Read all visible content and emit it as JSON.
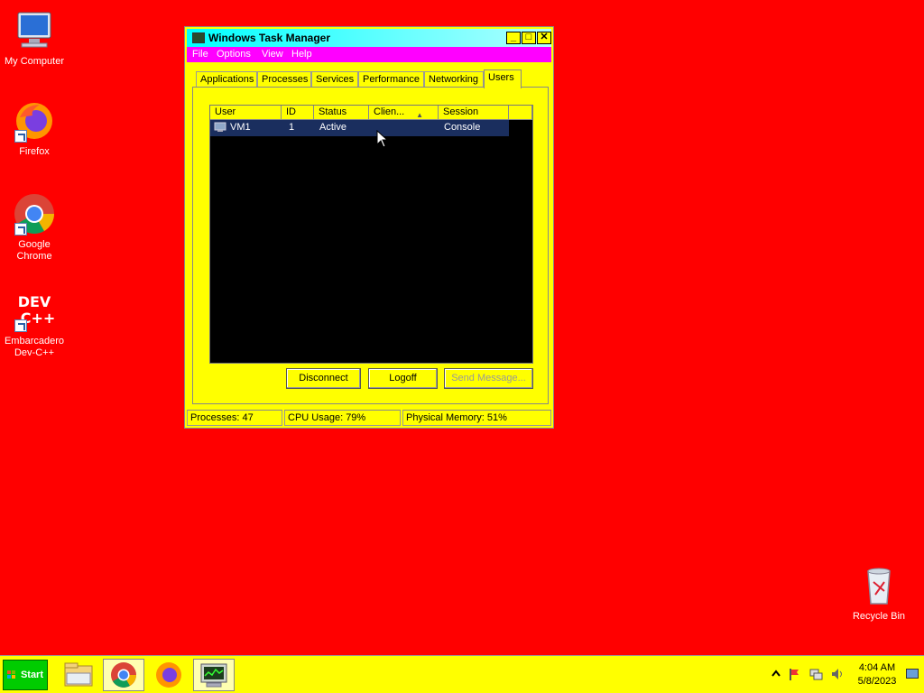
{
  "desktop": {
    "icons": [
      {
        "label": "My Computer"
      },
      {
        "label": "Firefox"
      },
      {
        "label": "Google Chrome"
      },
      {
        "label": "Embarcadero Dev-C++"
      },
      {
        "label": "Recycle Bin"
      }
    ]
  },
  "window": {
    "title": "Windows Task Manager",
    "menu": [
      "File",
      "Options",
      "View",
      "Help"
    ],
    "tabs": [
      "Applications",
      "Processes",
      "Services",
      "Performance",
      "Networking",
      "Users"
    ],
    "active_tab": "Users",
    "users_table": {
      "columns": [
        "User",
        "ID",
        "Status",
        "Clien...",
        "Session"
      ],
      "sorted_column": "Clien...",
      "rows": [
        {
          "user": "VM1",
          "id": "1",
          "status": "Active",
          "client": "",
          "session": "Console"
        }
      ]
    },
    "buttons": {
      "disconnect": "Disconnect",
      "logoff": "Logoff",
      "send_message": "Send Message..."
    },
    "status": {
      "processes": "Processes: 47",
      "cpu": "CPU Usage: 79%",
      "memory": "Physical Memory: 51%"
    }
  },
  "taskbar": {
    "start_label": "Start",
    "apps": [
      "file-explorer-icon",
      "chrome-icon",
      "firefox-icon",
      "task-manager-icon"
    ],
    "clock_time": "4:04 AM",
    "clock_date": "5/8/2023"
  },
  "colors": {
    "desktop": "#FF0000",
    "window_bg": "#FFFF00",
    "titlebar": "#00FFFF",
    "menubar": "#FF00FF",
    "selection": "#1A2E5E",
    "start_button": "#00CC00"
  }
}
